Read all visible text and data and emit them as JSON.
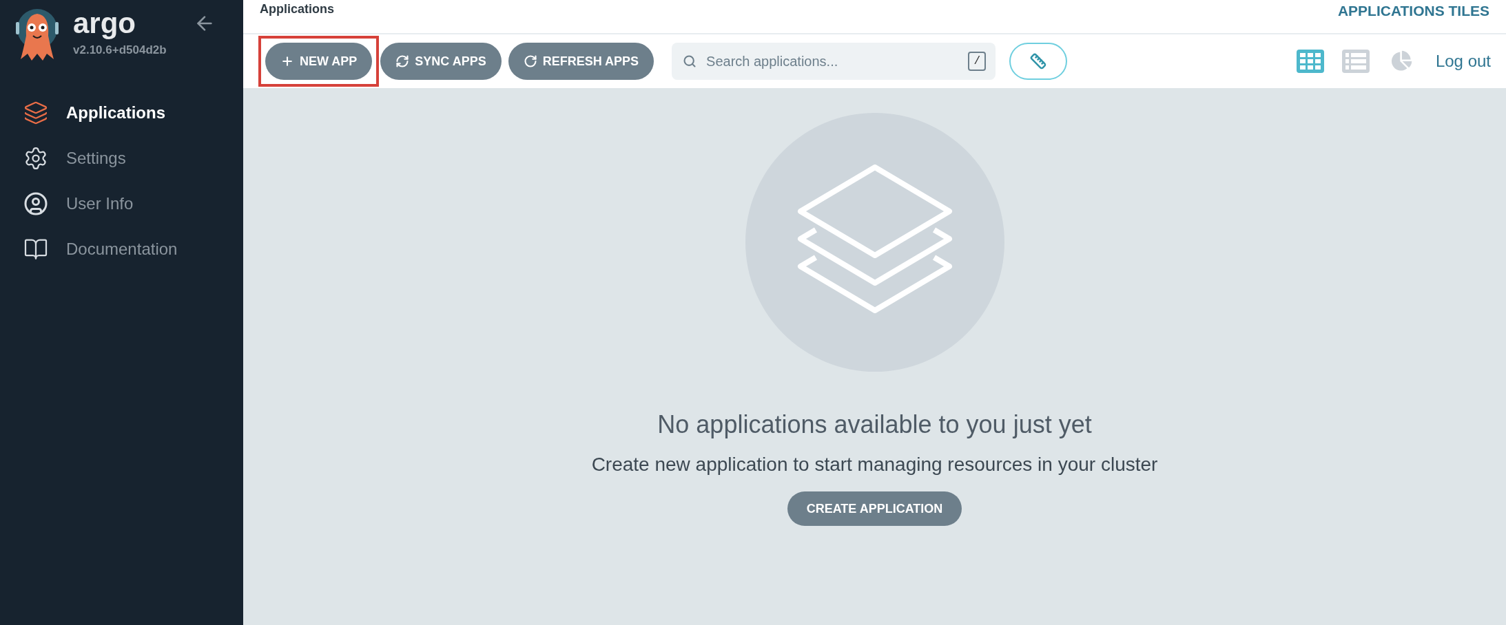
{
  "sidebar": {
    "logo_text": "argo",
    "version": "v2.10.6+d504d2b",
    "items": [
      {
        "label": "Applications",
        "kind": "layers",
        "selected": true
      },
      {
        "label": "Settings",
        "kind": "gears",
        "selected": false
      },
      {
        "label": "User Info",
        "kind": "user",
        "selected": false
      },
      {
        "label": "Documentation",
        "kind": "book",
        "selected": false
      }
    ]
  },
  "header": {
    "breadcrumb": "Applications",
    "page_title": "APPLICATIONS TILES"
  },
  "toolbar": {
    "buttons": [
      {
        "label": "NEW APP",
        "kind": "new",
        "highlighted": true
      },
      {
        "label": "SYNC APPS",
        "kind": "sync",
        "highlighted": false
      },
      {
        "label": "REFRESH APPS",
        "kind": "refresh",
        "highlighted": false
      }
    ],
    "search": {
      "placeholder": "Search applications...",
      "shortcut": "/"
    },
    "views": [
      {
        "kind": "tiles",
        "selected": true
      },
      {
        "kind": "list",
        "selected": false
      },
      {
        "kind": "summary",
        "selected": false
      }
    ],
    "logout": "Log out"
  },
  "empty_state": {
    "title": "No applications available to you just yet",
    "subtitle": "Create new application to start managing resources in your cluster",
    "button": "CREATE APPLICATION"
  }
}
